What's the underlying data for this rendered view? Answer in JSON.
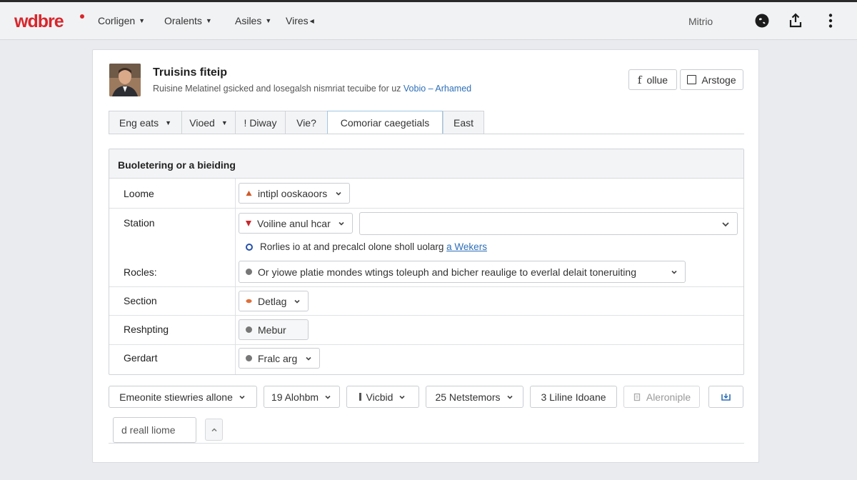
{
  "brand": {
    "logo": "wdbre",
    "accent": "#d8262b"
  },
  "nav": [
    {
      "label": "Corligen"
    },
    {
      "label": "Oralents"
    },
    {
      "label": "Asiles"
    },
    {
      "label": "Vires"
    }
  ],
  "topbar": {
    "user": "Mitrio",
    "icons": [
      "globe-icon",
      "share-icon",
      "more-vertical-icon"
    ]
  },
  "header": {
    "title": "Truisins fiteip",
    "subtitle_text": "Ruisine Melatinel gsicked and losegalsh nismriat tecuibe for uz",
    "subtitle_link1": "Vobio",
    "subtitle_sep": "–",
    "subtitle_link2": "Arhamed",
    "btn_filter": "ollue",
    "btn_filter_icon": "f",
    "btn_arstoge": "Arstoge"
  },
  "tabs": [
    {
      "label": "Eng eats",
      "caret": true
    },
    {
      "label": "Vioed",
      "caret": true
    },
    {
      "label": "! Diway",
      "caret": false
    },
    {
      "label": "Vie?",
      "caret": false
    },
    {
      "label": "Comoriar caegetials",
      "caret": false,
      "active": true
    },
    {
      "label": "East",
      "caret": false
    }
  ],
  "form": {
    "heading": "Buoletering or a bieiding",
    "rows": {
      "loome": {
        "label": "Loome",
        "value": "intipl ooskaoors"
      },
      "station": {
        "label": "Station",
        "value": "Voiline anul hcar",
        "second_value": "",
        "note": "Rorlies io at and precalcl olone sholl uolarg",
        "note_link": "a Wekers"
      },
      "rocles": {
        "label": "Rocles:",
        "value": "Or yiowe platie mondes wtings toleuph and bicher reaulige to everlal delait toneruiting"
      },
      "section": {
        "label": "Section",
        "value": "Detlag"
      },
      "reshpting": {
        "label": "Reshpting",
        "value": "Mebur"
      },
      "gerdart": {
        "label": "Gerdart",
        "value": "Fralc arg"
      }
    }
  },
  "footer": {
    "buttons": {
      "b1": "Emeonite stiewries allone",
      "b2": "19 Alohbm",
      "b3": "Vicbid",
      "b4": "25 Netstemors",
      "b5": "3 Liline Idoane",
      "b6": "Aleroniple"
    },
    "search": {
      "value": "d reall liome",
      "placeholder": ""
    }
  }
}
